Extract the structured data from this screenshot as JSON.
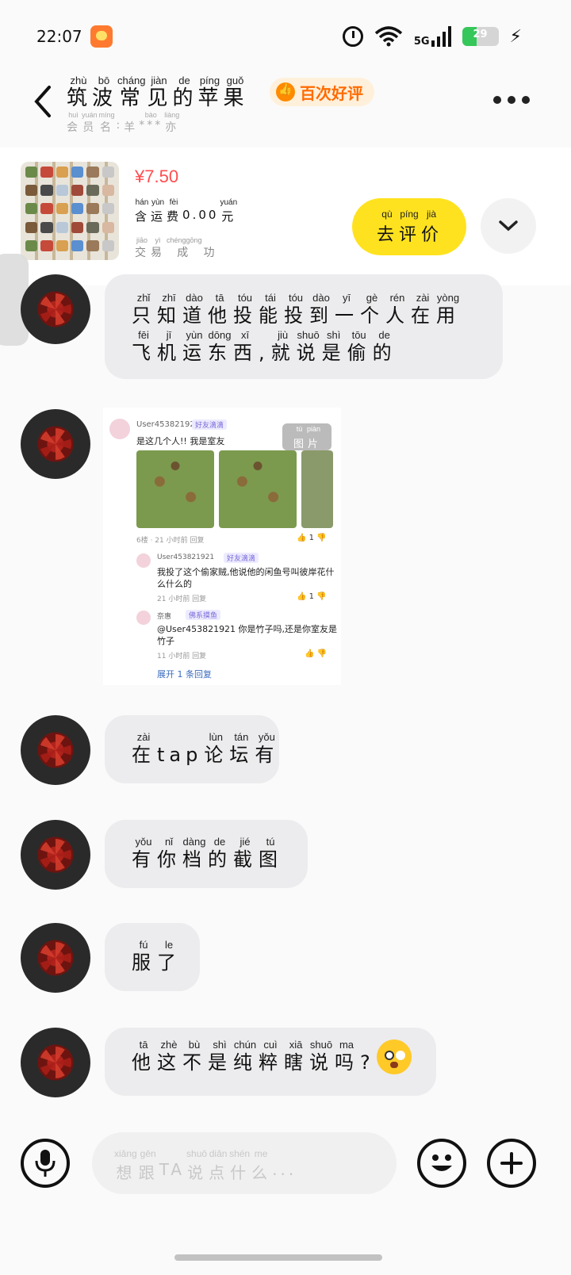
{
  "status_bar": {
    "time": "22:07",
    "network": "5G",
    "battery": "29"
  },
  "header": {
    "title_chars": [
      "筑",
      "波",
      "常",
      "见",
      "的",
      "苹",
      "果"
    ],
    "title_pinyin": [
      "zhù",
      "bō",
      "cháng",
      "jiàn",
      "de",
      "píng",
      "guǒ"
    ],
    "badge": "百次好评",
    "member_chars": [
      "会",
      "员",
      "名",
      ":",
      "羊",
      "***",
      "亦"
    ],
    "member_pinyin": [
      "huì",
      "yuán",
      "míng",
      "",
      "",
      "bào",
      "liàng"
    ]
  },
  "product": {
    "price": "¥7.50",
    "fee_chars": [
      "含",
      "运",
      "费"
    ],
    "fee_pinyin": [
      "hán",
      "yùn",
      "fèi"
    ],
    "fee_value": "0.00",
    "fee_unit": "元",
    "fee_unit_pinyin": "yuán",
    "status_chars": [
      "交",
      "易",
      "成",
      "功"
    ],
    "status_pinyin": [
      "jiāo",
      "yì",
      "chénggōng",
      ""
    ],
    "review_chars": [
      "去",
      "评",
      "价"
    ],
    "review_pinyin": [
      "qù",
      "píng",
      "jià"
    ]
  },
  "messages": [
    {
      "line1_chars": [
        "只",
        "知",
        "道",
        "他",
        "投",
        "能",
        "投",
        "到",
        "一",
        "个",
        "人",
        "在",
        "用"
      ],
      "line1_pinyin": [
        "zhǐ",
        "zhī",
        "dào",
        "tā",
        "tóu",
        "tái",
        "tóu",
        "dào",
        "yī",
        "gè",
        "rén",
        "zài",
        "yòng"
      ],
      "line2_chars": [
        "飞",
        "机",
        "运",
        "东",
        "西",
        ",",
        "就",
        "说",
        "是",
        "偷",
        "的"
      ],
      "line2_pinyin": [
        "fēi",
        "jī",
        "yùn",
        "dōng",
        "xī",
        "",
        "jiù",
        "shuō",
        "shì",
        "tōu",
        "de"
      ]
    },
    {
      "chars": [
        "在",
        "tap",
        "论",
        "坛",
        "有"
      ],
      "pinyin": [
        "zài",
        "",
        "lùn",
        "tán",
        "yǒu"
      ]
    },
    {
      "chars": [
        "有",
        "你",
        "档",
        "的",
        "截",
        "图"
      ],
      "pinyin": [
        "yǒu",
        "nǐ",
        "dàng",
        "de",
        "jié",
        "tú"
      ]
    },
    {
      "chars": [
        "服",
        "了"
      ],
      "pinyin": [
        "fú",
        "le"
      ]
    },
    {
      "chars": [
        "他",
        "这",
        "不",
        "是",
        "纯",
        "粹",
        "瞎",
        "说",
        "吗",
        "?"
      ],
      "pinyin": [
        "tā",
        "zhè",
        "bù",
        "shì",
        "chún",
        "cuì",
        "xiā",
        "shuō",
        "ma",
        ""
      ]
    }
  ],
  "image_message": {
    "tag_chars": [
      "图",
      "片"
    ],
    "tag_pinyin": [
      "tú",
      "piàn"
    ],
    "post_user": "User453821921",
    "post_user_tag": "好友滴滴",
    "post_text": "是这几个人!! 我是室友",
    "post_meta": "6楼 · 21 小时前  回复",
    "post_likes": "1",
    "reply1_user": "User453821921",
    "reply1_tag": "好友滴滴",
    "reply1_text": "我投了这个偷家贼,他说他的闲鱼号叫彼岸花什么什么的",
    "reply1_meta": "21 小时前  回复",
    "reply1_likes": "1",
    "reply2_user": "奈惠",
    "reply2_tag": "佛系摸鱼",
    "reply2_text": "@User453821921  你是竹子吗,还是你室友是竹子",
    "reply2_meta": "11 小时前  回复",
    "expand_text": "展开 1 条回复"
  },
  "input": {
    "placeholder_chars": [
      "想",
      "跟",
      "TA",
      "说",
      "点",
      "什",
      "么",
      "..."
    ],
    "placeholder_pinyin": [
      "xiǎng",
      "gēn",
      "",
      "shuō",
      "diǎn",
      "shén",
      "me",
      ""
    ]
  },
  "icons": {
    "back": "chevron-left-icon",
    "more": "more-dots-icon",
    "expand": "chevron-down-icon",
    "mic": "microphone-icon",
    "emoji": "smile-icon",
    "plus": "plus-icon"
  },
  "colors": {
    "price": "#ff4d4f",
    "review_button": "#ffe21f",
    "badge_text": "#ff6b00",
    "bubble": "#ececee"
  }
}
